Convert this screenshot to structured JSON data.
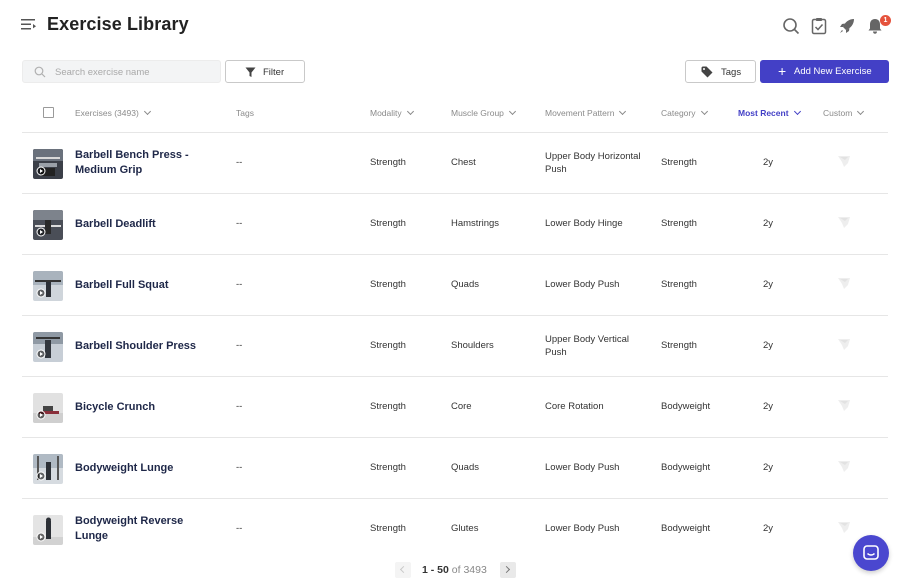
{
  "header": {
    "title": "Exercise Library",
    "notifications_count": "1"
  },
  "toolbar": {
    "search_placeholder": "Search exercise name",
    "filter_label": "Filter",
    "tags_label": "Tags",
    "add_label": "Add New Exercise"
  },
  "table": {
    "columns": {
      "exercises": "Exercises (3493)",
      "tags": "Tags",
      "modality": "Modality",
      "muscle_group": "Muscle Group",
      "movement_pattern": "Movement Pattern",
      "category": "Category",
      "most_recent": "Most Recent",
      "custom": "Custom"
    },
    "rows": [
      {
        "name": "Barbell Bench Press - Medium Grip",
        "tags": "--",
        "modality": "Strength",
        "muscle_group": "Chest",
        "movement_pattern": "Upper Body Horizontal Push",
        "category": "Strength",
        "recent": "2y"
      },
      {
        "name": "Barbell Deadlift",
        "tags": "--",
        "modality": "Strength",
        "muscle_group": "Hamstrings",
        "movement_pattern": "Lower Body Hinge",
        "category": "Strength",
        "recent": "2y"
      },
      {
        "name": "Barbell Full Squat",
        "tags": "--",
        "modality": "Strength",
        "muscle_group": "Quads",
        "movement_pattern": "Lower Body Push",
        "category": "Strength",
        "recent": "2y"
      },
      {
        "name": "Barbell Shoulder Press",
        "tags": "--",
        "modality": "Strength",
        "muscle_group": "Shoulders",
        "movement_pattern": "Upper Body Vertical Push",
        "category": "Strength",
        "recent": "2y"
      },
      {
        "name": "Bicycle Crunch",
        "tags": "--",
        "modality": "Strength",
        "muscle_group": "Core",
        "movement_pattern": "Core Rotation",
        "category": "Bodyweight",
        "recent": "2y"
      },
      {
        "name": "Bodyweight Lunge",
        "tags": "--",
        "modality": "Strength",
        "muscle_group": "Quads",
        "movement_pattern": "Lower Body Push",
        "category": "Bodyweight",
        "recent": "2y"
      },
      {
        "name": "Bodyweight Reverse Lunge",
        "tags": "--",
        "modality": "Strength",
        "muscle_group": "Glutes",
        "movement_pattern": "Lower Body Push",
        "category": "Bodyweight",
        "recent": "2y"
      }
    ]
  },
  "pagination": {
    "range": "1 - 50",
    "of_label": "of",
    "total": "3493"
  },
  "colors": {
    "accent": "#4340c6",
    "badge": "#e5533d",
    "title_text": "#1e2748"
  },
  "icons": {
    "menu": "menu-collapse-icon",
    "search": "search-icon",
    "tasks": "clipboard-check-icon",
    "launch": "rocket-icon",
    "notifications": "bell-icon",
    "filter": "funnel-icon",
    "tags": "tag-icon",
    "add": "plus-icon",
    "custom": "feather-icon",
    "chat": "chat-icon"
  }
}
